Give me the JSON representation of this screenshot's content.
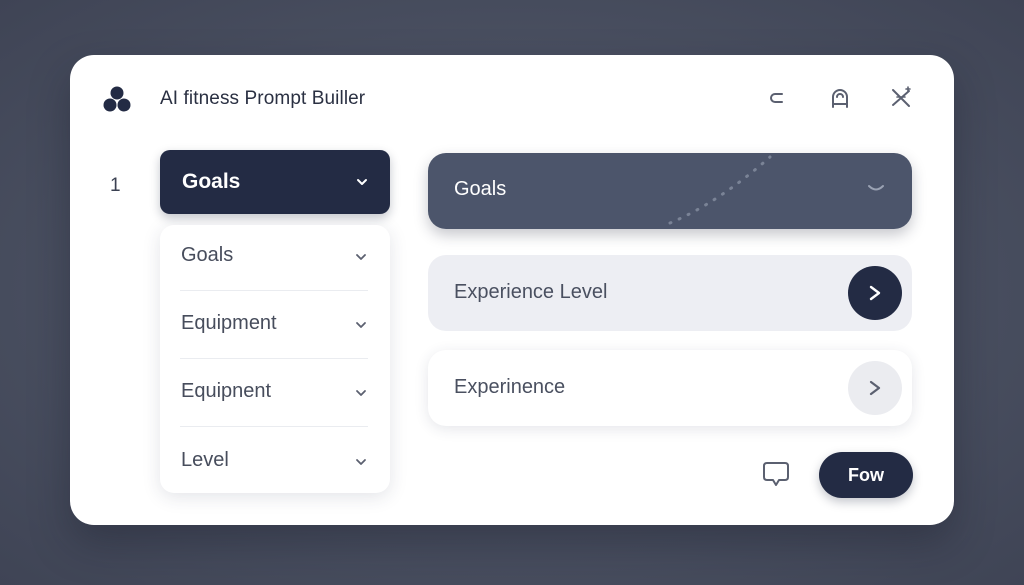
{
  "app": {
    "title": "AI fitness Prompt Builler"
  },
  "header_icons": [
    "back-icon",
    "profile-icon",
    "close-sparkle-icon"
  ],
  "step": {
    "number": "1"
  },
  "dropdown": {
    "selected": "Goals",
    "items": [
      {
        "label": "Goals"
      },
      {
        "label": "Equipment"
      },
      {
        "label": "Equipnent"
      },
      {
        "label": "Level"
      }
    ]
  },
  "panels": [
    {
      "label": "Goals",
      "state": "active"
    },
    {
      "label": "Experience Level",
      "state": "filled"
    },
    {
      "label": "Experinence",
      "state": "default"
    }
  ],
  "footer": {
    "primary_button": "Fow"
  },
  "colors": {
    "navy": "#232b44",
    "slate": "#4c556b",
    "background": "#4a5061"
  }
}
